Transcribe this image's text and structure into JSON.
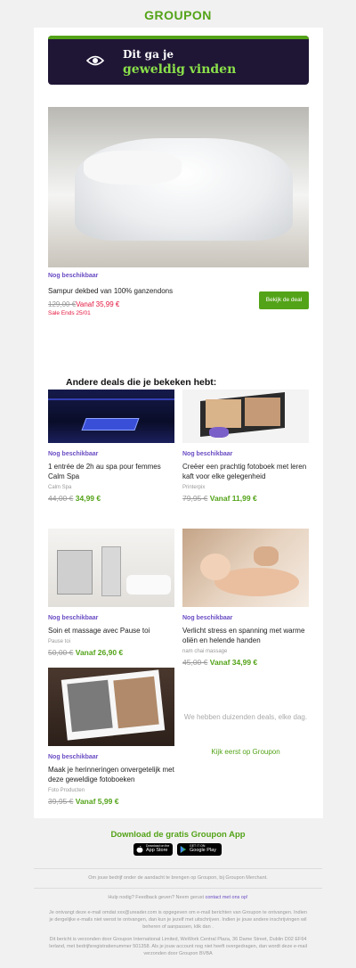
{
  "brand": {
    "logo_text": "GROUPON",
    "accent": "#53a318",
    "purple": "#6a4cc3",
    "red": "#e3173e"
  },
  "banner": {
    "line1": "Dit ga je",
    "line2": "geweldig vinden",
    "icon": "eye-icon"
  },
  "featured": {
    "availability": "Nog beschikbaar",
    "title": "Sampur dekbed van 100% ganzendons",
    "old_price": "129,00 €",
    "new_price": "Vanaf 35,99 €",
    "sale_ends": "Sale Ends 25/01",
    "button": "Bekijk de deal"
  },
  "others_heading": "Andere deals die je bekeken hebt:",
  "deals": [
    {
      "availability": "Nog beschikbaar",
      "title": "1 entrée de 2h au spa pour femmes Calm Spa",
      "merchant": "Calm Spa",
      "old_price": "44,00 €",
      "new_price": "34,99 €"
    },
    {
      "availability": "Nog beschikbaar",
      "title": "Creëer een prachtig fotoboek met leren kaft voor elke gelegenheid",
      "merchant": "Printerpix",
      "old_price": "79,95 €",
      "new_price": "Vanaf 11,99 €"
    },
    {
      "availability": "Nog beschikbaar",
      "title": "Soin et massage avec Pause toi",
      "merchant": "Pause toi",
      "old_price": "50,00 €",
      "new_price": "Vanaf 26,90 €"
    },
    {
      "availability": "Nog beschikbaar",
      "title": "Verlicht stress en spanning met warme oliën en helende handen",
      "merchant": "nam chai massage",
      "old_price": "45,00 €",
      "new_price": "Vanaf 34,99 €"
    },
    {
      "availability": "Nog beschikbaar",
      "title": "Maak je herinneringen onvergetelijk met deze geweldige fotoboeken",
      "merchant": "Foto Producten",
      "old_price": "39,95 €",
      "new_price": "Vanaf 5,99 €"
    }
  ],
  "info": {
    "text": "We hebben duizenden deals, elke dag.",
    "link": "Kijk eerst op Groupon"
  },
  "app": {
    "heading": "Download de gratis Groupon App",
    "appstore_small": "Download on the",
    "appstore_big": "App Store",
    "play_small": "GET IT ON",
    "play_big": "Google Play"
  },
  "footer": {
    "line1": "Om jouw bedrijf onder de aandacht te brengen op Groupon, bij Groupon Merchant.",
    "help_text": "Hulp nodig? Feedback geven? Neem gerust",
    "help_link": "contact met ons op!",
    "notice": "Je ontvangt deze e-mail omdat xxx@ureader.com is opgegeven om e-mail berichten van Groupon te ontvangen. Indien je dergelijke e-mails niet wenst te ontvangen, dan kun je jezelf met uitschrijven. Indien je jouw andere inschrijvingen wil beheren of aanpassen, klik dan .",
    "address": "Dit bericht is verzonden door Groupon International Limited, WeWork Central Plaza, 36 Dame Street, Dublin D02 EF64 Ierland, met bedrijfsregistratienummer 501358. Als je jouw account nog niet heeft overgedragen, dan wordt deze e-mail verzonden door Groupon BVBA"
  }
}
